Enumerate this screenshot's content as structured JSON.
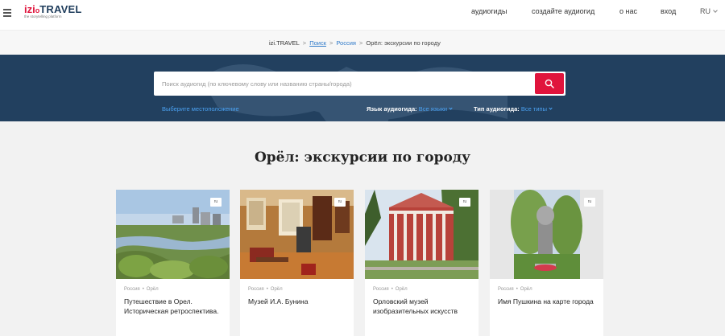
{
  "header": {
    "logo_izi": "izi",
    "logo_dot": "o",
    "logo_travel": "TRAVEL",
    "logo_tagline": "the storytelling platform",
    "nav": [
      {
        "label": "аудиогиды"
      },
      {
        "label": "создайте аудиогид"
      },
      {
        "label": "о нас"
      },
      {
        "label": "вход"
      }
    ],
    "language": "RU"
  },
  "breadcrumb": {
    "items": [
      {
        "label": "izi.TRAVEL"
      },
      {
        "label": "Поиск"
      },
      {
        "label": "Россия"
      },
      {
        "label": "Орёл: экскурсии по городу"
      }
    ],
    "separator": ">"
  },
  "search": {
    "placeholder": "Поиск аудиогид (по ключевому слову или названию страны/города)",
    "value": "",
    "locate_label": "Выберите местоположение",
    "lang_filter_label": "Язык аудиогида:",
    "lang_filter_value": "Все языки",
    "type_filter_label": "Тип аудиогида:",
    "type_filter_value": "Все типы"
  },
  "page": {
    "title": "Орёл: экскурсии по городу"
  },
  "cards": [
    {
      "country": "Россия",
      "city": "Орёл",
      "title": "Путешествие в Орел. Историческая ретроспектива.",
      "badge": "ru"
    },
    {
      "country": "Россия",
      "city": "Орёл",
      "title": "Музей И.А. Бунина",
      "badge": "ru"
    },
    {
      "country": "Россия",
      "city": "Орёл",
      "title": "Орловский музей изобразительных искусств",
      "badge": "ru"
    },
    {
      "country": "Россия",
      "city": "Орёл",
      "title": "Имя Пушкина на карте города",
      "badge": "ru"
    }
  ],
  "colors": {
    "brand_red": "#e0143c",
    "brand_navy": "#22405f",
    "link_blue": "#2f7ac9"
  }
}
